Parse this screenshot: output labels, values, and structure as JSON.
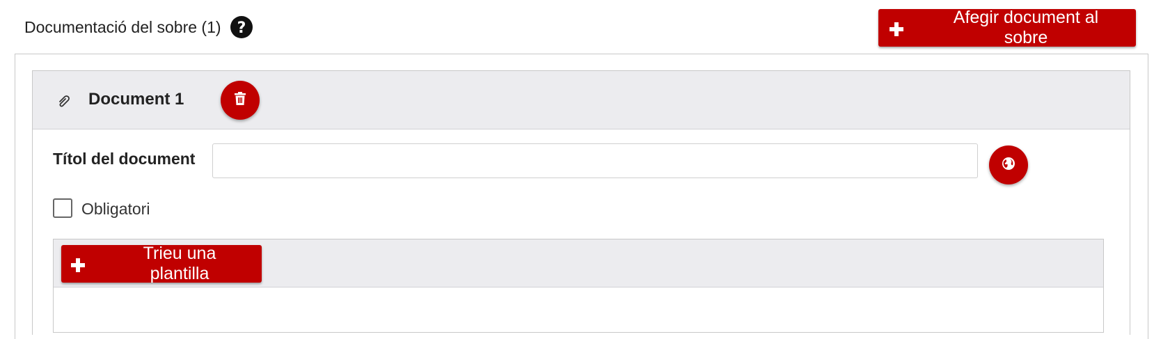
{
  "section": {
    "title": "Documentació del sobre (1)",
    "help_icon": "question-circle-icon"
  },
  "toolbar": {
    "add_document_label": "Afegir document al sobre",
    "add_icon": "plus-icon"
  },
  "document": {
    "title": "Document 1",
    "attachment_icon": "paperclip-icon",
    "delete_icon": "trash-icon",
    "title_field": {
      "label": "Títol del document",
      "value": "",
      "placeholder": ""
    },
    "translate_icon": "globe-icon",
    "mandatory": {
      "label": "Obligatori",
      "checked": false
    },
    "template": {
      "choose_label": "Trieu una plantilla",
      "add_icon": "plus-icon"
    }
  },
  "colors": {
    "accent": "#c00000",
    "panel_header_bg": "#ececef",
    "border": "#c8c8c8"
  }
}
